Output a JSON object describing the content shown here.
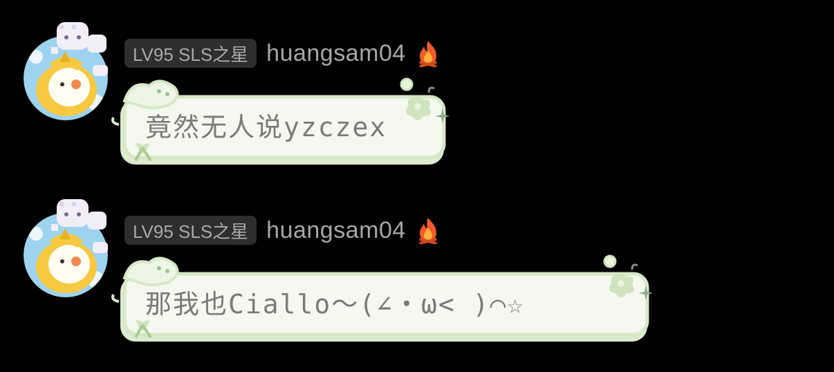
{
  "messages": [
    {
      "level_badge": "LV95 SLS之星",
      "username": "huangsam04",
      "badge_icon": "fire-icon",
      "text": "竟然无人说yzczex"
    },
    {
      "level_badge": "LV95 SLS之星",
      "username": "huangsam04",
      "badge_icon": "fire-icon",
      "text": "那我也Ciallo～(∠・ω< )⌒☆"
    }
  ],
  "colors": {
    "background": "#000000",
    "badge_bg": "#2e2e30",
    "name_text": "#a7a7aa",
    "bubble_fill": "#f4f8ee",
    "bubble_border": "#d6e8c6",
    "bubble_accent": "#b8d9a4",
    "avatar_bg": "#9ed3f0",
    "avatar_yellow": "#f6c940"
  }
}
